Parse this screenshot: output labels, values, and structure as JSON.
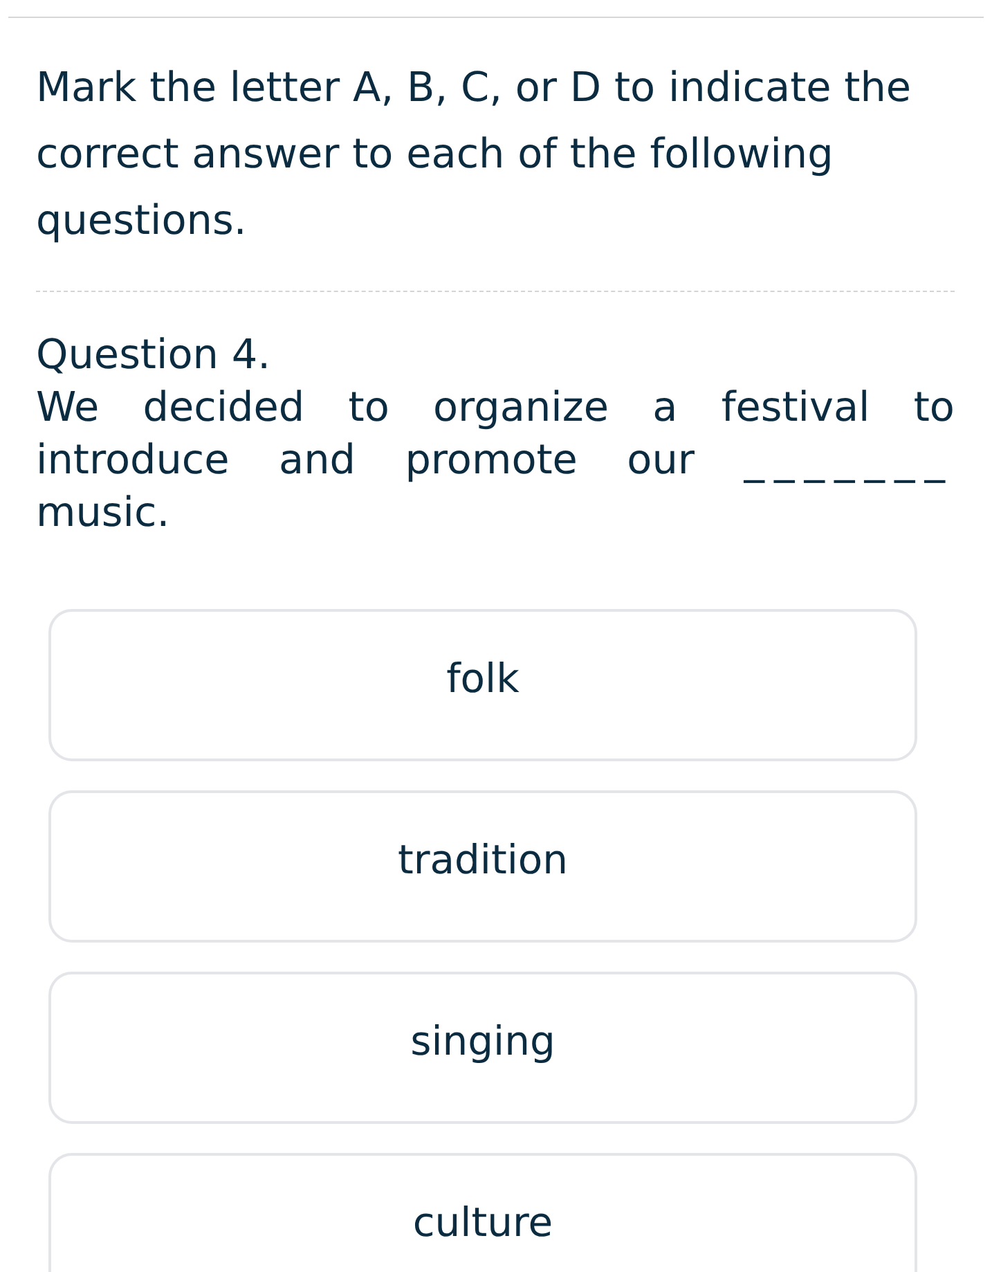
{
  "instructions": "Mark the letter A, B, C, or D to indicate the correct answer to each of the following questions.",
  "question": {
    "number": "Question 4.",
    "text": "We decided to organize a festival to introduce and promote our _______ music."
  },
  "options": [
    {
      "label": "folk",
      "selected": false
    },
    {
      "label": "tradition",
      "selected": false
    },
    {
      "label": "singing",
      "selected": false
    },
    {
      "label": "culture",
      "selected": false
    }
  ]
}
